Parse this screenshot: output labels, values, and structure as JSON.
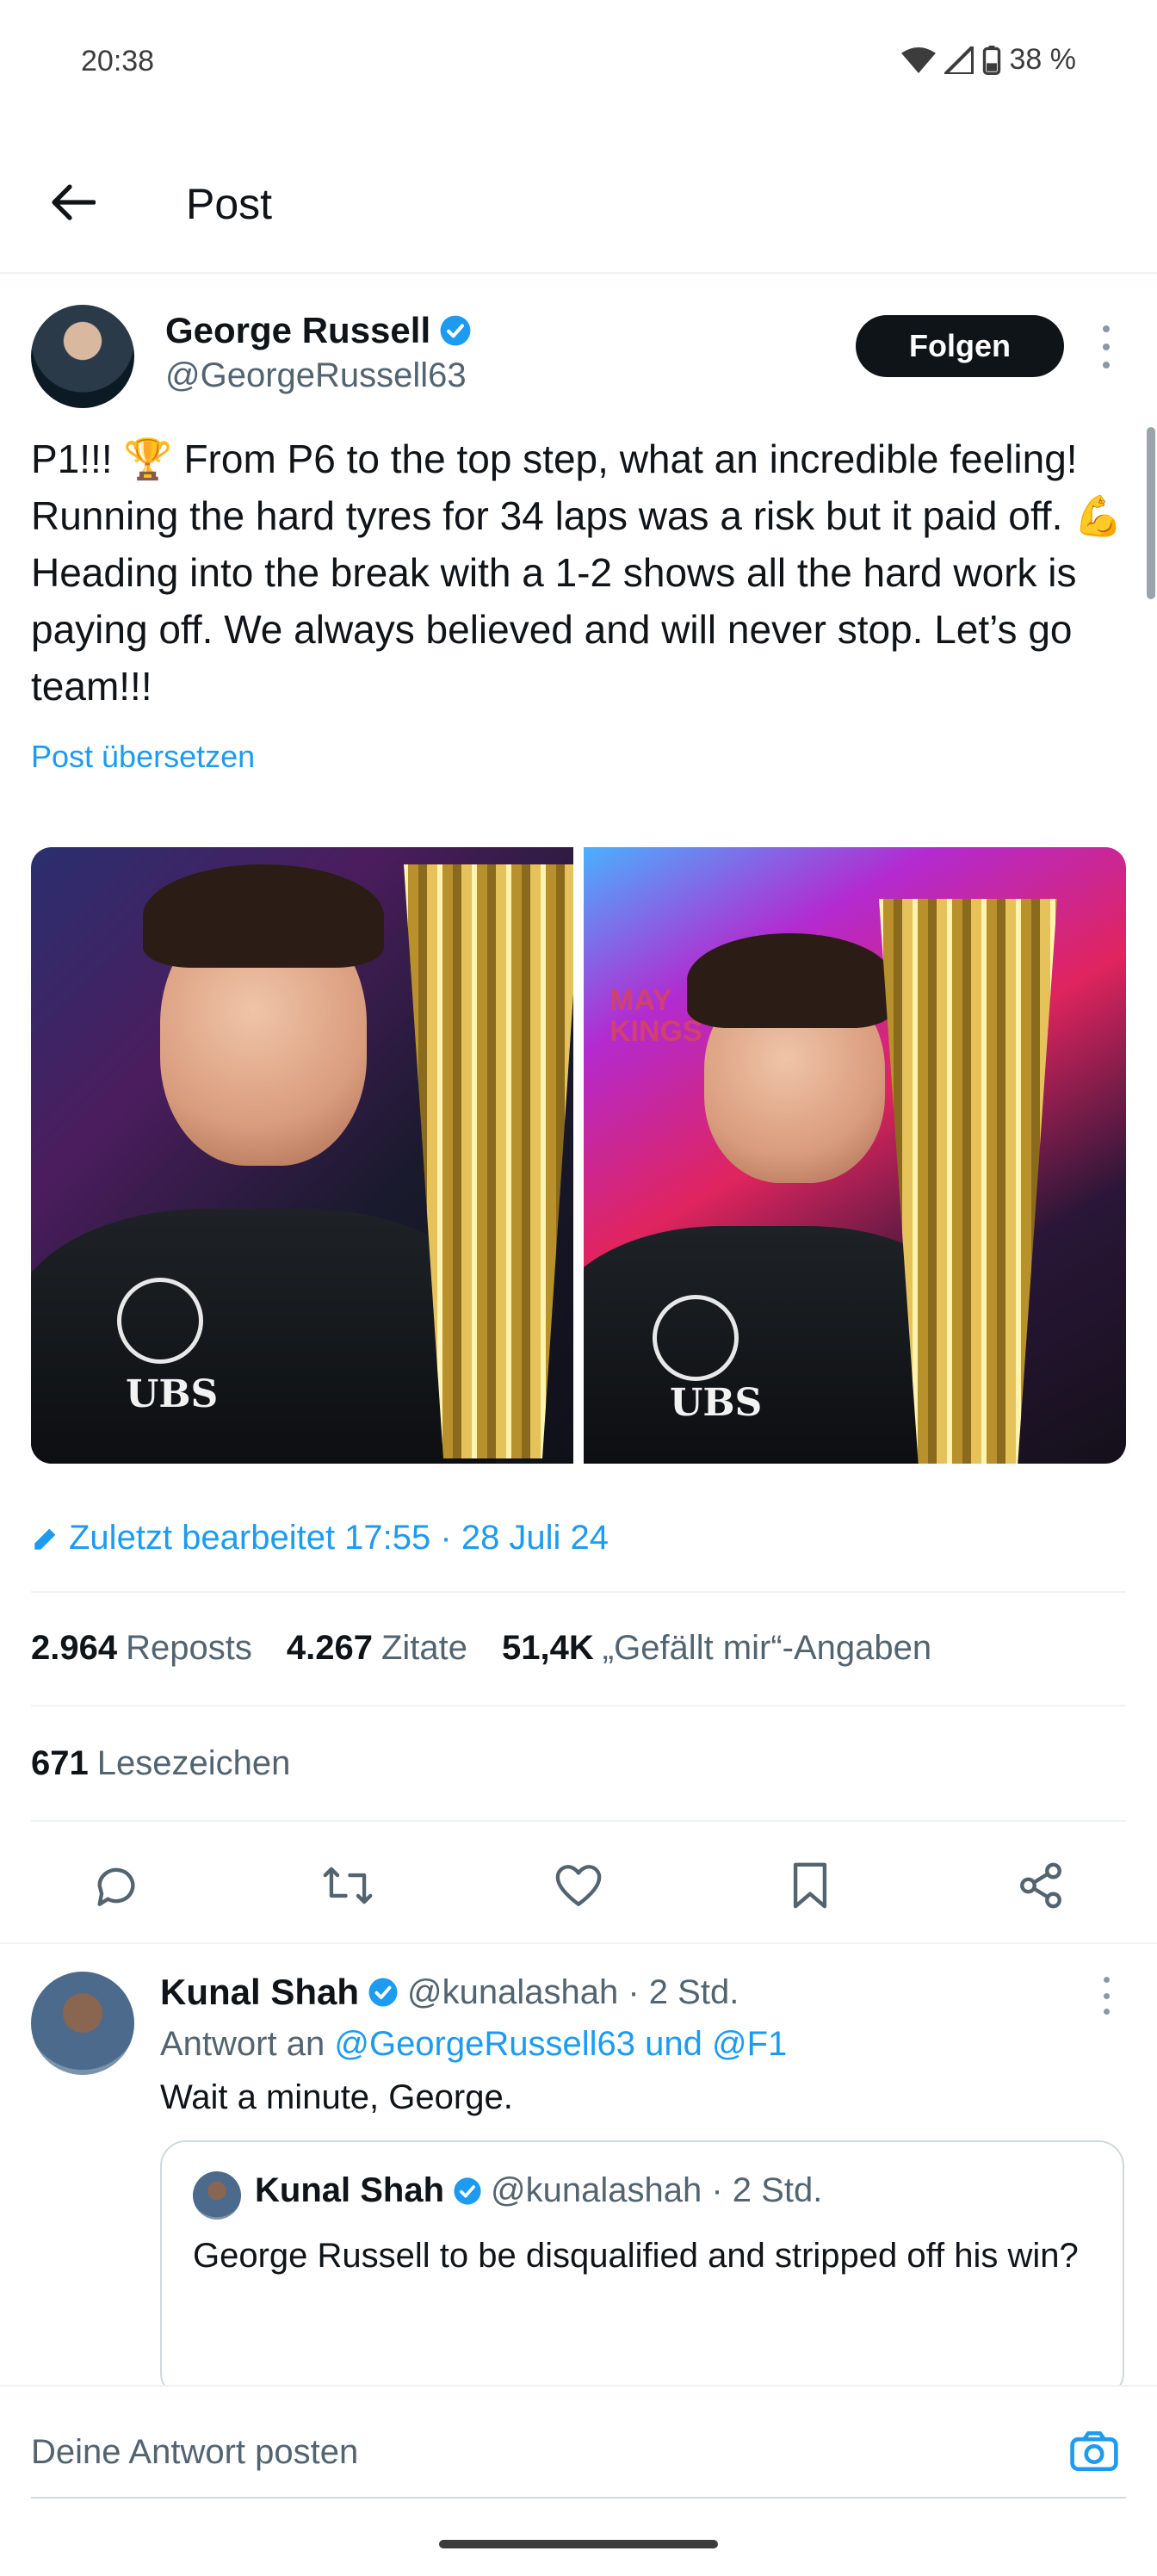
{
  "status_bar": {
    "time": "20:38",
    "battery": "38 %"
  },
  "header": {
    "title": "Post"
  },
  "post": {
    "author_name": "George Russell",
    "author_handle": "@GeorgeRussell63",
    "follow_label": "Folgen",
    "text": "P1!!! 🏆 From P6 to the top step, what an incredible feeling! Running the hard tyres for 34 laps was a risk but it paid off. 💪 Heading into the break with a 1-2 shows all the hard work is paying off. We always believed and will never stop. Let’s go team!!!",
    "translate_label": "Post übersetzen",
    "edited_label": "Zuletzt bearbeitet 17:55 · 28 Juli 24",
    "image_text": {
      "brand": "UBS",
      "sign": "MAY KINGS"
    },
    "stats": {
      "reposts_value": "2.964",
      "reposts_label": "Reposts",
      "quotes_value": "4.267",
      "quotes_label": "Zitate",
      "likes_value": "51,4K",
      "likes_label": "„Gefällt mir“-Angaben",
      "bookmarks_value": "671",
      "bookmarks_label": "Lesezeichen"
    },
    "actions": [
      "reply-icon",
      "repost-icon",
      "like-icon",
      "bookmark-icon",
      "share-icon"
    ]
  },
  "reply": {
    "name": "Kunal Shah",
    "handle_time": "@kunalashah · 2 Std.",
    "replying_prefix": "Antwort an",
    "replying_to": "@GeorgeRussell63 und @F1",
    "text": "Wait a minute, George.",
    "quote": {
      "name": "Kunal Shah",
      "handle_time": "@kunalashah · 2 Std.",
      "text": "George Russell to be disqualified and stripped off his win?"
    }
  },
  "compose": {
    "placeholder": "Deine Antwort posten"
  },
  "colors": {
    "accent": "#1d9bf0",
    "text": "#0f1419",
    "muted": "#536471"
  }
}
